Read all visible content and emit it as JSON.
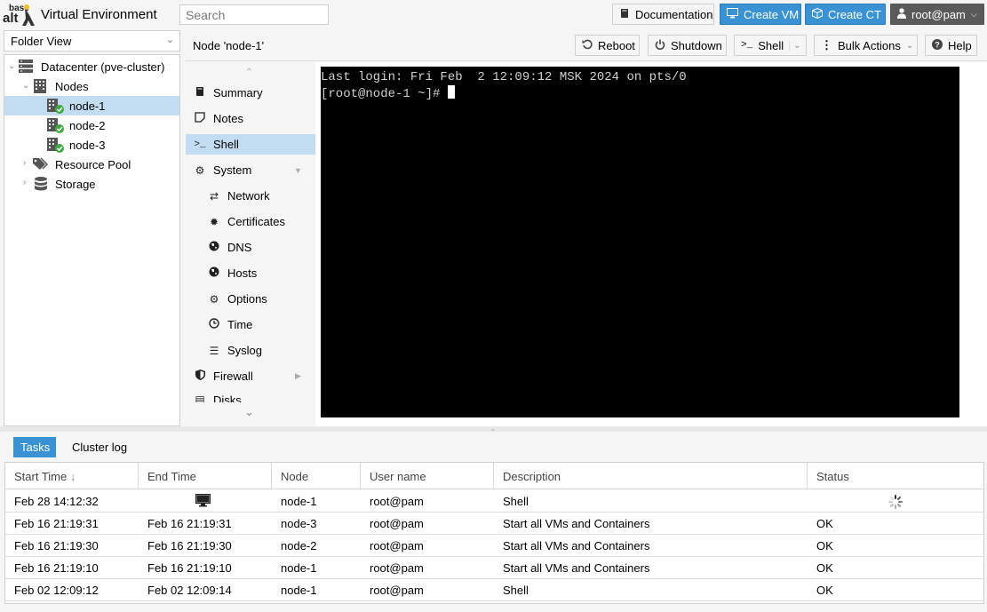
{
  "header": {
    "logo_text_top": "base",
    "logo_text_bottom": "alt",
    "title": "Virtual Environment",
    "search_placeholder": "Search",
    "documentation_label": "Documentation",
    "create_vm_label": "Create VM",
    "create_ct_label": "Create CT",
    "user_label": "root@pam"
  },
  "sidebar": {
    "view_selector": "Folder View",
    "tree": [
      {
        "label": "Datacenter (pve-cluster)",
        "icon": "server-icon"
      },
      {
        "label": "Nodes",
        "icon": "building-icon"
      },
      {
        "label": "node-1",
        "icon": "node-online-icon"
      },
      {
        "label": "node-2",
        "icon": "node-online-icon"
      },
      {
        "label": "node-3",
        "icon": "node-online-icon"
      },
      {
        "label": "Resource Pool",
        "icon": "tags-icon"
      },
      {
        "label": "Storage",
        "icon": "database-icon"
      }
    ]
  },
  "content": {
    "title": "Node 'node-1'",
    "toolbar": {
      "reboot": "Reboot",
      "shutdown": "Shutdown",
      "shell": "Shell",
      "bulk_actions": "Bulk Actions",
      "help": "Help"
    },
    "nav": [
      {
        "label": "Summary",
        "icon": "book-icon"
      },
      {
        "label": "Notes",
        "icon": "sticky-note-icon"
      },
      {
        "label": "Shell",
        "icon": "terminal-icon"
      },
      {
        "label": "System",
        "icon": "cogs-icon"
      },
      {
        "label": "Network",
        "icon": "exchange-icon"
      },
      {
        "label": "Certificates",
        "icon": "certificate-icon"
      },
      {
        "label": "DNS",
        "icon": "globe-icon"
      },
      {
        "label": "Hosts",
        "icon": "globe-icon"
      },
      {
        "label": "Options",
        "icon": "gear-icon"
      },
      {
        "label": "Time",
        "icon": "clock-icon"
      },
      {
        "label": "Syslog",
        "icon": "list-icon"
      },
      {
        "label": "Firewall",
        "icon": "shield-icon"
      },
      {
        "label": "Disks",
        "icon": "hdd-icon"
      }
    ],
    "terminal": {
      "line1": "Last login: Fri Feb  2 12:09:12 MSK 2024 on pts/0",
      "line2": "[root@node-1 ~]# "
    }
  },
  "bottom": {
    "tabs": [
      "Tasks",
      "Cluster log"
    ],
    "columns": [
      "Start Time",
      "End Time",
      "Node",
      "User name",
      "Description",
      "Status"
    ],
    "rows": [
      {
        "start": "Feb 28 14:12:32",
        "end": "",
        "node": "node-1",
        "user": "root@pam",
        "desc": "Shell",
        "status": ""
      },
      {
        "start": "Feb 16 21:19:31",
        "end": "Feb 16 21:19:31",
        "node": "node-3",
        "user": "root@pam",
        "desc": "Start all VMs and Containers",
        "status": "OK"
      },
      {
        "start": "Feb 16 21:19:30",
        "end": "Feb 16 21:19:30",
        "node": "node-2",
        "user": "root@pam",
        "desc": "Start all VMs and Containers",
        "status": "OK"
      },
      {
        "start": "Feb 16 21:19:10",
        "end": "Feb 16 21:19:10",
        "node": "node-1",
        "user": "root@pam",
        "desc": "Start all VMs and Containers",
        "status": "OK"
      },
      {
        "start": "Feb 02 12:09:12",
        "end": "Feb 02 12:09:14",
        "node": "node-1",
        "user": "root@pam",
        "desc": "Shell",
        "status": "OK"
      }
    ]
  },
  "colors": {
    "accent": "#3892d4",
    "selection": "#c2ddf2",
    "ok_green": "#3eaa3e"
  }
}
